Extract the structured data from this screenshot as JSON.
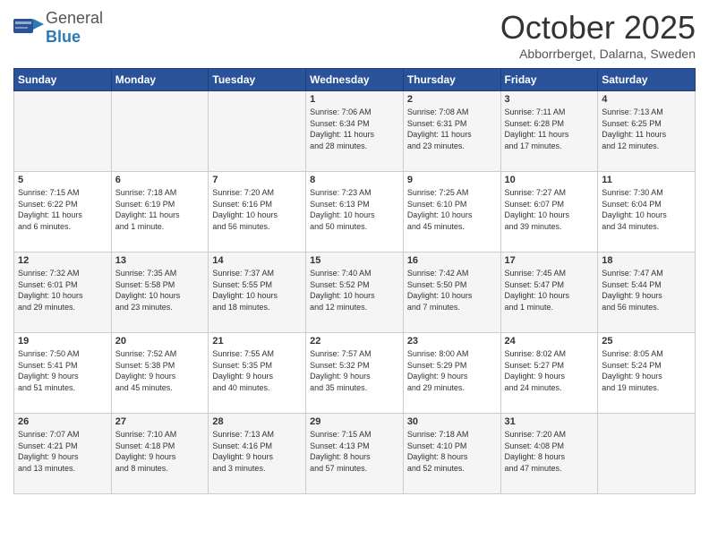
{
  "header": {
    "logo_line1": "General",
    "logo_line2": "Blue",
    "title": "October 2025",
    "subtitle": "Abborrberget, Dalarna, Sweden"
  },
  "days_of_week": [
    "Sunday",
    "Monday",
    "Tuesday",
    "Wednesday",
    "Thursday",
    "Friday",
    "Saturday"
  ],
  "weeks": [
    [
      {
        "day": "",
        "info": ""
      },
      {
        "day": "",
        "info": ""
      },
      {
        "day": "",
        "info": ""
      },
      {
        "day": "1",
        "info": "Sunrise: 7:06 AM\nSunset: 6:34 PM\nDaylight: 11 hours\nand 28 minutes."
      },
      {
        "day": "2",
        "info": "Sunrise: 7:08 AM\nSunset: 6:31 PM\nDaylight: 11 hours\nand 23 minutes."
      },
      {
        "day": "3",
        "info": "Sunrise: 7:11 AM\nSunset: 6:28 PM\nDaylight: 11 hours\nand 17 minutes."
      },
      {
        "day": "4",
        "info": "Sunrise: 7:13 AM\nSunset: 6:25 PM\nDaylight: 11 hours\nand 12 minutes."
      }
    ],
    [
      {
        "day": "5",
        "info": "Sunrise: 7:15 AM\nSunset: 6:22 PM\nDaylight: 11 hours\nand 6 minutes."
      },
      {
        "day": "6",
        "info": "Sunrise: 7:18 AM\nSunset: 6:19 PM\nDaylight: 11 hours\nand 1 minute."
      },
      {
        "day": "7",
        "info": "Sunrise: 7:20 AM\nSunset: 6:16 PM\nDaylight: 10 hours\nand 56 minutes."
      },
      {
        "day": "8",
        "info": "Sunrise: 7:23 AM\nSunset: 6:13 PM\nDaylight: 10 hours\nand 50 minutes."
      },
      {
        "day": "9",
        "info": "Sunrise: 7:25 AM\nSunset: 6:10 PM\nDaylight: 10 hours\nand 45 minutes."
      },
      {
        "day": "10",
        "info": "Sunrise: 7:27 AM\nSunset: 6:07 PM\nDaylight: 10 hours\nand 39 minutes."
      },
      {
        "day": "11",
        "info": "Sunrise: 7:30 AM\nSunset: 6:04 PM\nDaylight: 10 hours\nand 34 minutes."
      }
    ],
    [
      {
        "day": "12",
        "info": "Sunrise: 7:32 AM\nSunset: 6:01 PM\nDaylight: 10 hours\nand 29 minutes."
      },
      {
        "day": "13",
        "info": "Sunrise: 7:35 AM\nSunset: 5:58 PM\nDaylight: 10 hours\nand 23 minutes."
      },
      {
        "day": "14",
        "info": "Sunrise: 7:37 AM\nSunset: 5:55 PM\nDaylight: 10 hours\nand 18 minutes."
      },
      {
        "day": "15",
        "info": "Sunrise: 7:40 AM\nSunset: 5:52 PM\nDaylight: 10 hours\nand 12 minutes."
      },
      {
        "day": "16",
        "info": "Sunrise: 7:42 AM\nSunset: 5:50 PM\nDaylight: 10 hours\nand 7 minutes."
      },
      {
        "day": "17",
        "info": "Sunrise: 7:45 AM\nSunset: 5:47 PM\nDaylight: 10 hours\nand 1 minute."
      },
      {
        "day": "18",
        "info": "Sunrise: 7:47 AM\nSunset: 5:44 PM\nDaylight: 9 hours\nand 56 minutes."
      }
    ],
    [
      {
        "day": "19",
        "info": "Sunrise: 7:50 AM\nSunset: 5:41 PM\nDaylight: 9 hours\nand 51 minutes."
      },
      {
        "day": "20",
        "info": "Sunrise: 7:52 AM\nSunset: 5:38 PM\nDaylight: 9 hours\nand 45 minutes."
      },
      {
        "day": "21",
        "info": "Sunrise: 7:55 AM\nSunset: 5:35 PM\nDaylight: 9 hours\nand 40 minutes."
      },
      {
        "day": "22",
        "info": "Sunrise: 7:57 AM\nSunset: 5:32 PM\nDaylight: 9 hours\nand 35 minutes."
      },
      {
        "day": "23",
        "info": "Sunrise: 8:00 AM\nSunset: 5:29 PM\nDaylight: 9 hours\nand 29 minutes."
      },
      {
        "day": "24",
        "info": "Sunrise: 8:02 AM\nSunset: 5:27 PM\nDaylight: 9 hours\nand 24 minutes."
      },
      {
        "day": "25",
        "info": "Sunrise: 8:05 AM\nSunset: 5:24 PM\nDaylight: 9 hours\nand 19 minutes."
      }
    ],
    [
      {
        "day": "26",
        "info": "Sunrise: 7:07 AM\nSunset: 4:21 PM\nDaylight: 9 hours\nand 13 minutes."
      },
      {
        "day": "27",
        "info": "Sunrise: 7:10 AM\nSunset: 4:18 PM\nDaylight: 9 hours\nand 8 minutes."
      },
      {
        "day": "28",
        "info": "Sunrise: 7:13 AM\nSunset: 4:16 PM\nDaylight: 9 hours\nand 3 minutes."
      },
      {
        "day": "29",
        "info": "Sunrise: 7:15 AM\nSunset: 4:13 PM\nDaylight: 8 hours\nand 57 minutes."
      },
      {
        "day": "30",
        "info": "Sunrise: 7:18 AM\nSunset: 4:10 PM\nDaylight: 8 hours\nand 52 minutes."
      },
      {
        "day": "31",
        "info": "Sunrise: 7:20 AM\nSunset: 4:08 PM\nDaylight: 8 hours\nand 47 minutes."
      },
      {
        "day": "",
        "info": ""
      }
    ]
  ]
}
